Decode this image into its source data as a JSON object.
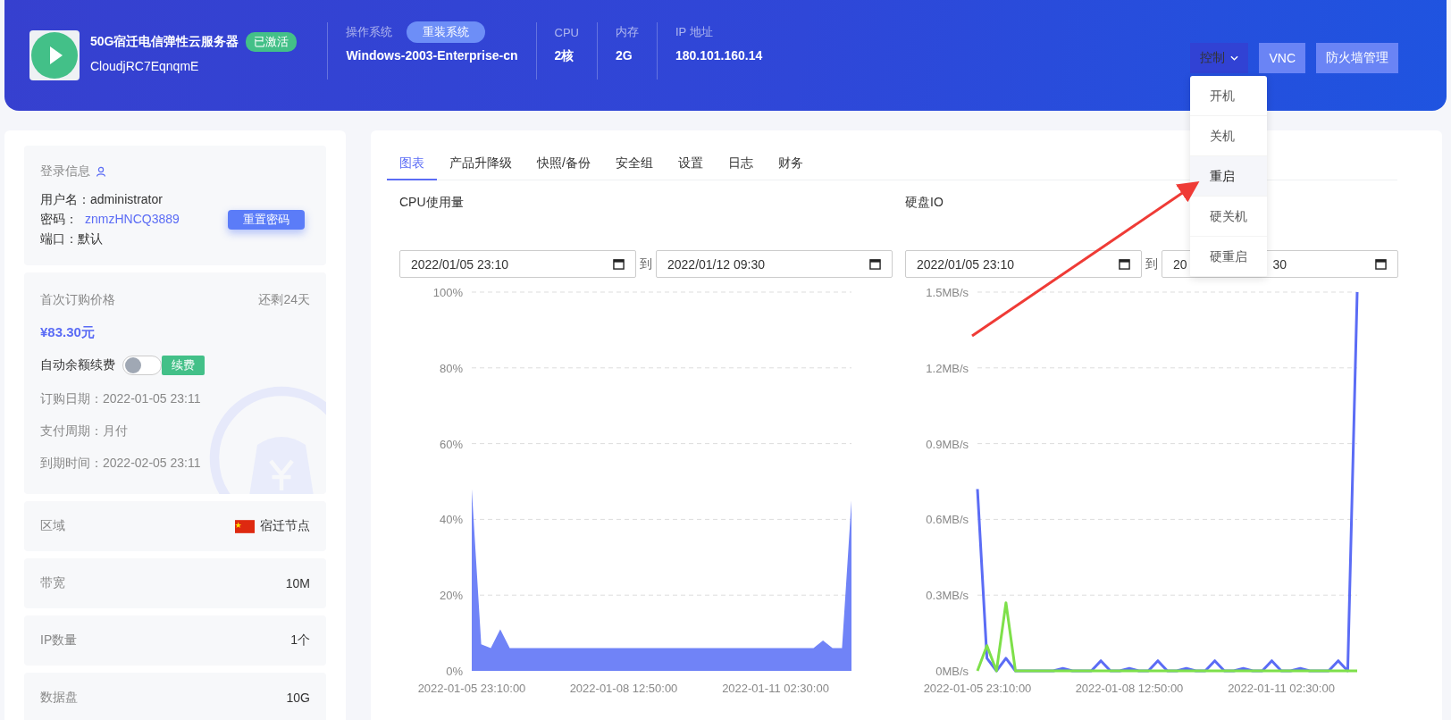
{
  "header": {
    "product_name": "50G宿迁电信弹性云服务器",
    "status_badge": "已激活",
    "instance_id": "CloudjRC7EqnqmE",
    "os_label": "操作系统",
    "reinstall_button": "重装系统",
    "os_value": "Windows-2003-Enterprise-cn",
    "specs": [
      {
        "label": "CPU",
        "value": "2核"
      },
      {
        "label": "内存",
        "value": "2G"
      },
      {
        "label": "IP 地址",
        "value": "180.101.160.14"
      }
    ],
    "control_button": "控制",
    "vnc_button": "VNC",
    "firewall_button": "防火墙管理"
  },
  "control_menu": [
    {
      "label": "开机",
      "selected": false
    },
    {
      "label": "关机",
      "selected": false
    },
    {
      "label": "重启",
      "selected": true
    },
    {
      "label": "硬关机",
      "selected": false
    },
    {
      "label": "硬重启",
      "selected": false
    }
  ],
  "login_info": {
    "title": "登录信息",
    "username_label": "用户名：",
    "username": "administrator",
    "password_label": "密码：",
    "password": "znmzHNCQ3889",
    "port_label": "端口：",
    "port": "默认",
    "reset_button": "重置密码"
  },
  "billing": {
    "price_label": "首次订购价格",
    "remaining": "还剩24天",
    "price": "¥83.30元",
    "auto_renew_label": "自动余额续费",
    "auto_renew_on": false,
    "renew_button": "续费",
    "details": [
      {
        "label": "订购日期：",
        "value": "2022-01-05 23:11"
      },
      {
        "label": "支付周期：",
        "value": "月付"
      },
      {
        "label": "到期时间：",
        "value": "2022-02-05 23:11"
      }
    ]
  },
  "properties": [
    {
      "label": "区域",
      "value": "宿迁节点",
      "kind": "flag"
    },
    {
      "label": "带宽",
      "value": "10M",
      "kind": "text"
    },
    {
      "label": "IP数量",
      "value": "1个",
      "kind": "text"
    },
    {
      "label": "数据盘",
      "value": "10G",
      "kind": "text"
    }
  ],
  "tabs": [
    {
      "label": "图表",
      "selected": true
    },
    {
      "label": "产品升降级",
      "selected": false
    },
    {
      "label": "快照/备份",
      "selected": false
    },
    {
      "label": "安全组",
      "selected": false
    },
    {
      "label": "设置",
      "selected": false
    },
    {
      "label": "日志",
      "selected": false
    },
    {
      "label": "财务",
      "selected": false
    }
  ],
  "charts": [
    {
      "title": "CPU使用量",
      "start": "2022/01/05 23:10",
      "separator": "到",
      "end": [
        "2022/01/12 09:30"
      ],
      "chart_data": {
        "type": "area",
        "grid": true,
        "categories": [
          "2022-01-05 23:10:00",
          null,
          null,
          null,
          null,
          null,
          null,
          null,
          null,
          null,
          null,
          null,
          null,
          null,
          null,
          null,
          "2022-01-08 12:50:00",
          null,
          null,
          null,
          null,
          null,
          null,
          null,
          null,
          null,
          null,
          null,
          null,
          null,
          null,
          null,
          "2022-01-11 02:30:00",
          null,
          null,
          null,
          null,
          null,
          null,
          null,
          null
        ],
        "series": [
          {
            "color": "#7083f7",
            "values": [
              48,
              7,
              6,
              11,
              6,
              6,
              6,
              6,
              6,
              6,
              6,
              6,
              6,
              6,
              6,
              6,
              6,
              6,
              6,
              6,
              6,
              6,
              6,
              6,
              6,
              6,
              6,
              6,
              6,
              6,
              6,
              6,
              6,
              6,
              6,
              6,
              6,
              8,
              6,
              6,
              45
            ]
          }
        ],
        "ylim": [
          0,
          100
        ],
        "yticks": [
          {
            "value": 0,
            "label": "0%"
          },
          {
            "value": 20,
            "label": "20%"
          },
          {
            "value": 40,
            "label": "40%"
          },
          {
            "value": 60,
            "label": "60%"
          },
          {
            "value": 80,
            "label": "80%"
          },
          {
            "value": 100,
            "label": "100%"
          }
        ]
      }
    },
    {
      "title": "硬盘IO",
      "start": "2022/01/05 23:10",
      "separator": "到",
      "end": [
        "20",
        "30"
      ],
      "chart_data": {
        "type": "line",
        "grid": true,
        "categories": [
          "2022-01-05 23:10:00",
          null,
          null,
          null,
          null,
          null,
          null,
          null,
          null,
          null,
          null,
          null,
          null,
          null,
          null,
          null,
          "2022-01-08 12:50:00",
          null,
          null,
          null,
          null,
          null,
          null,
          null,
          null,
          null,
          null,
          null,
          null,
          null,
          null,
          null,
          "2022-01-11 02:30:00",
          null,
          null,
          null,
          null,
          null,
          null,
          null,
          null
        ],
        "series": [
          {
            "color": "#5b6cf5",
            "values": [
              0.72,
              0.05,
              0,
              0.05,
              0,
              0,
              0,
              0,
              0,
              0.01,
              0,
              0,
              0,
              0.04,
              0,
              0,
              0.01,
              0,
              0,
              0.04,
              0,
              0,
              0.01,
              0,
              0,
              0.04,
              0,
              0,
              0.01,
              0,
              0,
              0.04,
              0,
              0,
              0.01,
              0,
              0,
              0,
              0.04,
              0,
              1.5
            ]
          },
          {
            "color": "#7ee04a",
            "values": [
              0,
              0.1,
              0,
              0.27,
              0,
              0,
              0,
              0,
              0,
              0,
              0,
              0,
              0,
              0,
              0,
              0,
              0,
              0,
              0,
              0,
              0,
              0,
              0,
              0,
              0,
              0,
              0,
              0,
              0,
              0,
              0,
              0,
              0,
              0,
              0,
              0,
              0,
              0,
              0,
              0,
              0
            ]
          }
        ],
        "ylim": [
          0,
          1.5
        ],
        "yticks": [
          {
            "value": 0,
            "label": "0MB/s"
          },
          {
            "value": 0.3,
            "label": "0.3MB/s"
          },
          {
            "value": 0.6,
            "label": "0.6MB/s"
          },
          {
            "value": 0.9,
            "label": "0.9MB/s"
          },
          {
            "value": 1.2,
            "label": "1.2MB/s"
          },
          {
            "value": 1.5,
            "label": "1.5MB/s"
          }
        ]
      }
    }
  ]
}
